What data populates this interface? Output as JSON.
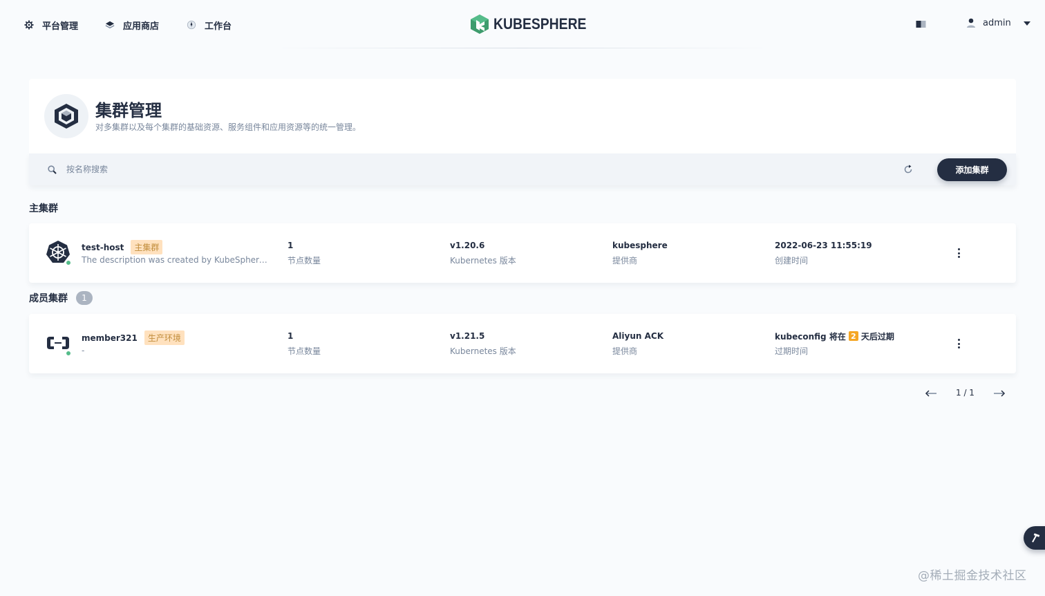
{
  "topnav": {
    "platform_label": "平台管理",
    "appstore_label": "应用商店",
    "workbench_label": "工作台",
    "logo_text": "KUBESPHERE",
    "username": "admin"
  },
  "banner": {
    "title": "集群管理",
    "description": "对多集群以及每个集群的基础资源、服务组件和应用资源等的统一管理。"
  },
  "toolbar": {
    "search_placeholder": "按名称搜索",
    "add_label": "添加集群"
  },
  "host_section": {
    "label": "主集群",
    "cluster": {
      "name": "test-host",
      "tag": "主集群",
      "description": "The description was created by KubeSphere automatically. It is recommended that you use the Host Cluster to manage clusters only and deploy workloads on Member Clusters.",
      "nodes_value": "1",
      "nodes_label": "节点数量",
      "version_value": "v1.20.6",
      "version_label": "Kubernetes 版本",
      "provider_value": "kubesphere",
      "provider_label": "提供商",
      "time_value": "2022-06-23 11:55:19",
      "time_label": "创建时间"
    }
  },
  "member_section": {
    "label": "成员集群",
    "count": "1",
    "cluster": {
      "name": "member321",
      "tag": "生产环境",
      "description": "-",
      "nodes_value": "1",
      "nodes_label": "节点数量",
      "version_value": "v1.21.5",
      "version_label": "Kubernetes 版本",
      "provider_value": "Aliyun ACK",
      "provider_label": "提供商",
      "expire_prefix": "kubeconfig 将在",
      "expire_days": "2",
      "expire_suffix": "天后过期",
      "expire_label": "过期时间"
    }
  },
  "pagination": {
    "text": "1 / 1"
  },
  "watermark": "@稀土掘金技术社区",
  "colors": {
    "dark": "#242e42",
    "muted": "#79879c",
    "status_green": "#55bc8a",
    "tag_bg": "#ffe1be",
    "tag_text": "#c18d3c",
    "warning_badge": "#f5a623",
    "brand_green": "#3e9c6d"
  },
  "icons": [
    "gear-icon",
    "layers-icon",
    "compass-icon",
    "kubesphere-logo",
    "book-icon",
    "user-icon",
    "caret-down-icon",
    "cube-icon",
    "search-icon",
    "refresh-icon",
    "kubernetes-icon",
    "aliyun-icon",
    "more-icon",
    "arrow-left-icon",
    "arrow-right-icon",
    "hammer-icon"
  ]
}
